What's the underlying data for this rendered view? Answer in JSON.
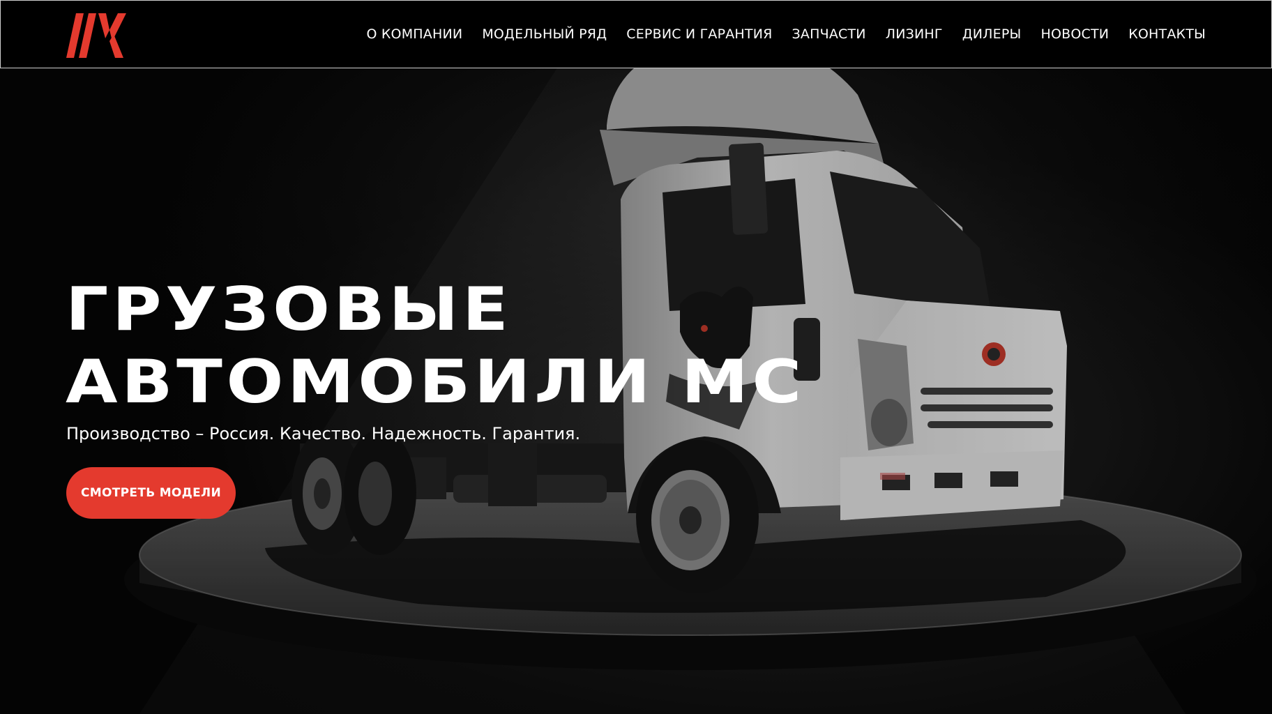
{
  "brand": {
    "accent_color": "#e43a2e",
    "logo_icon": "mc-logo-icon"
  },
  "nav": {
    "items": [
      {
        "label": "О КОМПАНИИ"
      },
      {
        "label": "МОДЕЛЬНЫЙ РЯД"
      },
      {
        "label": "СЕРВИС И ГАРАНТИЯ"
      },
      {
        "label": "ЗАПЧАСТИ"
      },
      {
        "label": "ЛИЗИНГ"
      },
      {
        "label": "ДИЛЕРЫ"
      },
      {
        "label": "НОВОСТИ"
      },
      {
        "label": "КОНТАКТЫ"
      }
    ]
  },
  "hero": {
    "title_line1": "ГРУЗОВЫЕ",
    "title_line2": "АВТОМОБИЛИ МС",
    "subtitle": "Производство – Россия. Качество. Надежность. Гарантия.",
    "cta_label": "СМОТРЕТЬ МОДЕЛИ",
    "image": "white-truck-on-podium-with-bull-emblem"
  }
}
